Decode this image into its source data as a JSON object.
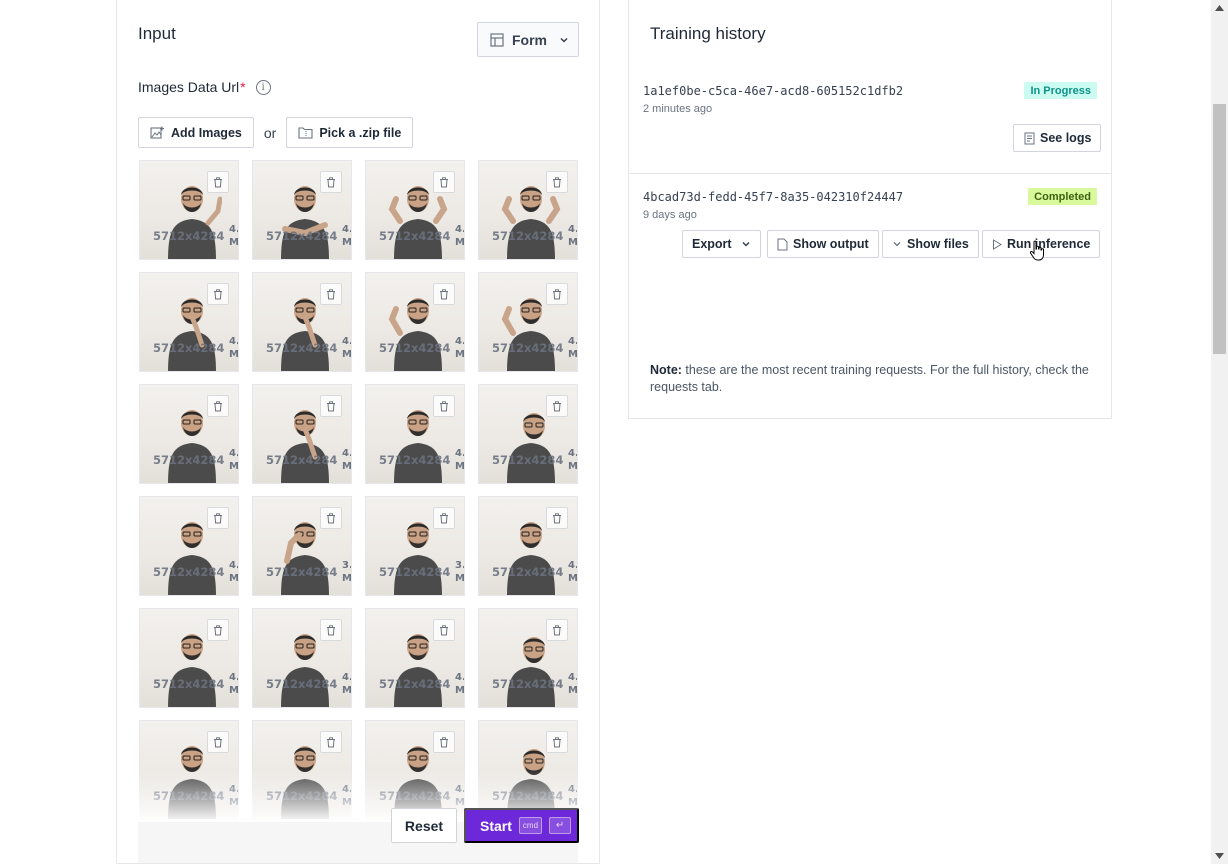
{
  "input_panel": {
    "title": "Input",
    "form_button": "Form",
    "field_label": "Images Data Url",
    "required_mark": "*",
    "info_glyph": "i",
    "add_images": "Add Images",
    "or": "or",
    "pick_zip": "Pick a .zip file",
    "images": [
      {
        "dims": "5712x4284",
        "size": "4.",
        "unit": "MB",
        "pose": "point-up"
      },
      {
        "dims": "5712x4284",
        "size": "4.",
        "unit": "MB",
        "pose": "arm-cross"
      },
      {
        "dims": "5712x4284",
        "size": "4.",
        "unit": "MB",
        "pose": "flex-both"
      },
      {
        "dims": "5712x4284",
        "size": "4.",
        "unit": "MB",
        "pose": "flex-both"
      },
      {
        "dims": "5712x4284",
        "size": "4.",
        "unit": "MB",
        "pose": "think"
      },
      {
        "dims": "5712x4284",
        "size": "4.",
        "unit": "MB",
        "pose": "think"
      },
      {
        "dims": "5712x4284",
        "size": "4.",
        "unit": "MB",
        "pose": "flex-one"
      },
      {
        "dims": "5712x4284",
        "size": "4.",
        "unit": "MB",
        "pose": "flex-one"
      },
      {
        "dims": "5712x4284",
        "size": "4.",
        "unit": "MB",
        "pose": "stand"
      },
      {
        "dims": "5712x4284",
        "size": "4.",
        "unit": "MB",
        "pose": "think"
      },
      {
        "dims": "5712x4284",
        "size": "4.",
        "unit": "MB",
        "pose": "stand"
      },
      {
        "dims": "5712x4284",
        "size": "4.",
        "unit": "MB",
        "pose": "look-down"
      },
      {
        "dims": "5712x4284",
        "size": "4.",
        "unit": "MB",
        "pose": "stand"
      },
      {
        "dims": "5712x4284",
        "size": "3.",
        "unit": "MB",
        "pose": "neck"
      },
      {
        "dims": "5712x4284",
        "size": "3.",
        "unit": "MB",
        "pose": "stand"
      },
      {
        "dims": "5712x4284",
        "size": "4.",
        "unit": "MB",
        "pose": "stand"
      },
      {
        "dims": "5712x4284",
        "size": "4.",
        "unit": "MB",
        "pose": "stand"
      },
      {
        "dims": "5712x4284",
        "size": "4.",
        "unit": "MB",
        "pose": "stand"
      },
      {
        "dims": "5712x4284",
        "size": "4.",
        "unit": "MB",
        "pose": "stand"
      },
      {
        "dims": "5712x4284",
        "size": "4.",
        "unit": "MB",
        "pose": "look-down"
      },
      {
        "dims": "5712x4284",
        "size": "4.",
        "unit": "MB",
        "pose": "stand"
      },
      {
        "dims": "5712x4284",
        "size": "4.",
        "unit": "MB",
        "pose": "stand"
      },
      {
        "dims": "5712x4284",
        "size": "4.",
        "unit": "MB",
        "pose": "stand"
      },
      {
        "dims": "5712x4284",
        "size": "4.",
        "unit": "MB",
        "pose": "look-down"
      }
    ],
    "reset": "Reset",
    "start": "Start",
    "kbd_cmd": "cmd",
    "kbd_enter": "↵"
  },
  "training_history": {
    "title": "Training history",
    "requests": [
      {
        "id": "1a1ef0be-c5ca-46e7-acd8-605152c1dfb2",
        "time": "2 minutes ago",
        "status": "In Progress",
        "see_logs": "See logs"
      },
      {
        "id": "4bcad73d-fedd-45f7-8a35-042310f24447",
        "time": "9 days ago",
        "status": "Completed",
        "export": "Export",
        "show_output": "Show output",
        "show_files": "Show files",
        "run_inference": "Run inference"
      }
    ],
    "note_label": "Note:",
    "note_text": " these are the most recent training requests. For the full history, check the requests tab."
  },
  "colors": {
    "accent": "#6d28d9",
    "progress_badge": "#ccfbf1",
    "completed_badge": "#d9f99d"
  }
}
